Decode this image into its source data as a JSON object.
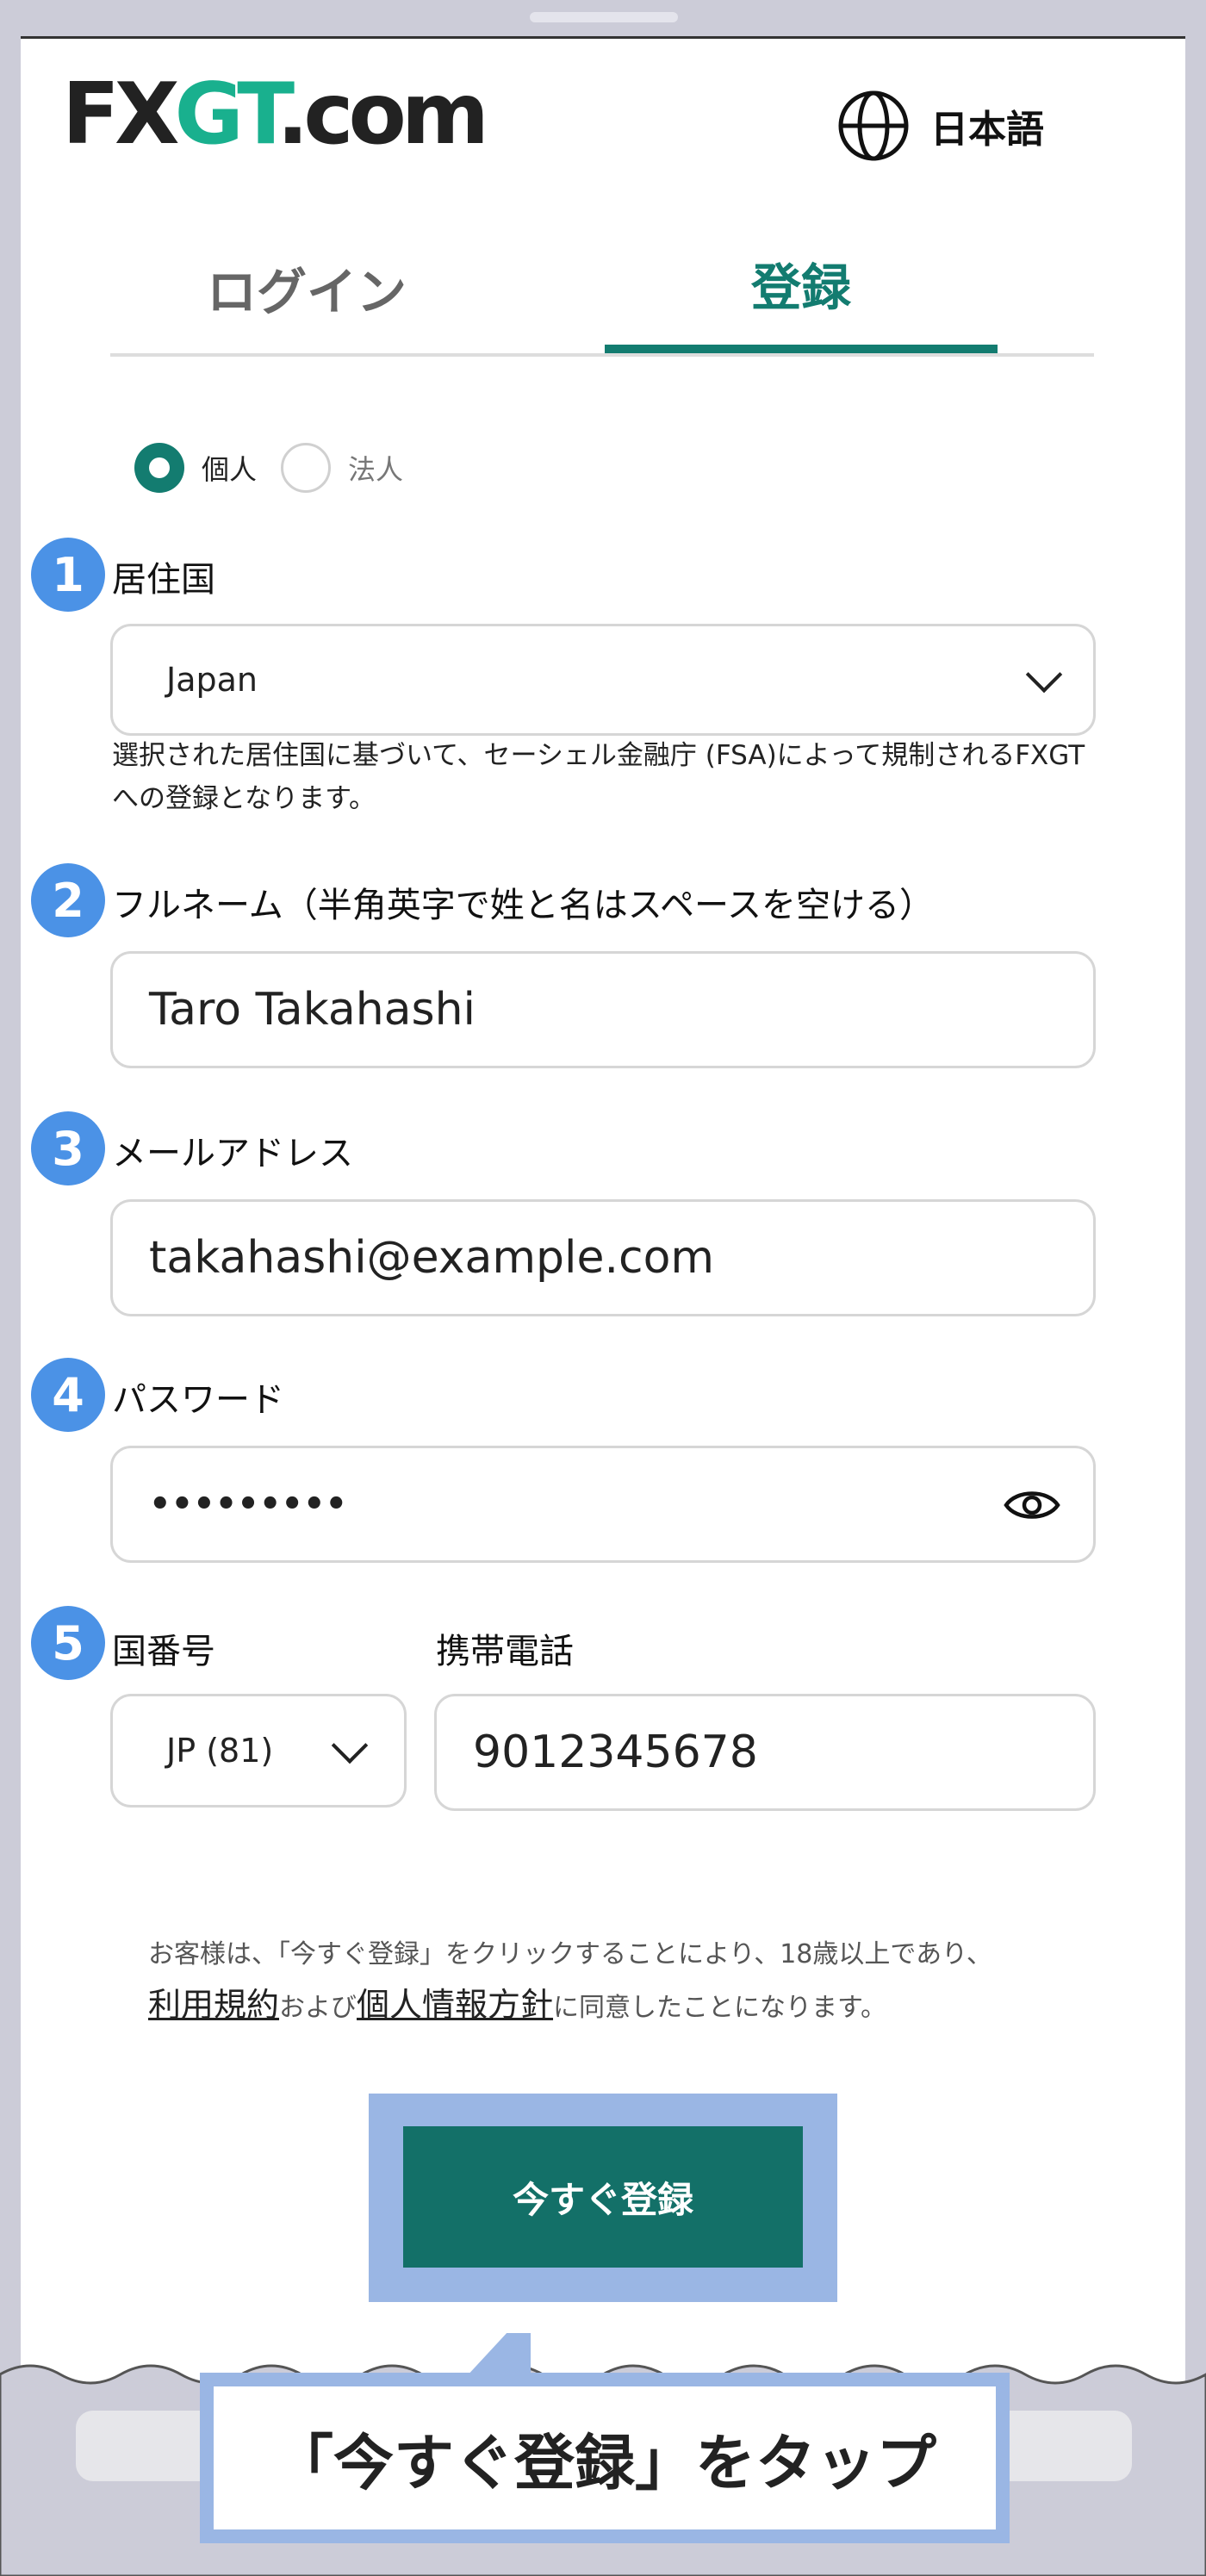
{
  "logo": {
    "part1": "FX",
    "part2": "GT",
    ".com": ".com"
  },
  "header": {
    "language": "日本語"
  },
  "tabs": {
    "login": "ログイン",
    "register": "登録"
  },
  "account_type": {
    "individual": "個人",
    "corporate": "法人"
  },
  "steps": [
    "1",
    "2",
    "3",
    "4",
    "5"
  ],
  "country": {
    "label": "居住国",
    "value": "Japan",
    "note": "選択された居住国に基づいて、セーシェル金融庁 (FSA)によって規制されるFXGTへの登録となります。"
  },
  "fullname": {
    "label": "フルネーム（半角英字で姓と名はスペースを空ける）",
    "value": "Taro Takahashi"
  },
  "email": {
    "label": "メールアドレス",
    "value": "takahashi@example.com"
  },
  "password": {
    "label": "パスワード",
    "value": "•••••••••"
  },
  "phone": {
    "code_label": "国番号",
    "code_value": "JP (81)",
    "number_label": "携帯電話",
    "number_value": "9012345678"
  },
  "consent": {
    "prefix": "お客様は、「今すぐ登録」をクリックすることにより、18歳以上であり、",
    "terms": "利用規約",
    "and": "および",
    "privacy": "個人情報方針",
    "suffix": "に同意したことになります。"
  },
  "cta": {
    "label": "今すぐ登録"
  },
  "callout": {
    "text": "「今すぐ登録」をタップ"
  },
  "colors": {
    "accent": "#137c70",
    "step": "#4b92e6",
    "highlight": "#9ab6e4"
  }
}
